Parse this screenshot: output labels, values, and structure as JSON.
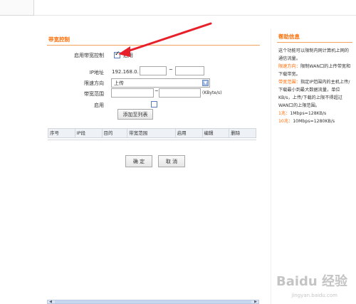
{
  "main": {
    "title": "带宽控制",
    "enable_label": "启用带宽控制",
    "enable_checkbox_text": "启用",
    "ip_label": "IP地址",
    "ip_prefix": "192.168.0.",
    "ip_separator": "~",
    "direction_label": "限速方向",
    "direction_value": "上传",
    "range_label": "带宽范围",
    "range_separator": "~",
    "range_unit": "(KByte/s)",
    "enable_row_label": "启用",
    "add_button": "添加至列表",
    "table_headers": [
      "序号",
      "IP段",
      "目的",
      "带宽范围",
      "启用",
      "编辑",
      "删除"
    ],
    "confirm_button": "确 定",
    "cancel_button": "取 消",
    "enable_checked": true,
    "row_enable_checked": false
  },
  "help": {
    "title": "帮助信息",
    "intro": "这个功能可以限制内网计算机上网的通信流量。",
    "direction_term": "限速方向：",
    "direction_desc": "限制WAN口的上传带宽和下载带宽。",
    "range_term": "带宽范围：",
    "range_desc": "指定IP范围内的主机上传/下载最小到最大数据流量，单位KB/s，上传/下载的上限不得超过WAN口的上限范围。",
    "line1_term": "1兆：",
    "line1_desc": "1Mbps=128KB/s",
    "line2_term": "10兆：",
    "line2_desc": "10Mbps=1280KB/s"
  },
  "watermark": {
    "brand": "Baidu 经验",
    "site": "jingyan.baidu.com"
  },
  "colors": {
    "accent": "#ff6a00",
    "annotation_arrow": "#e8202a"
  }
}
